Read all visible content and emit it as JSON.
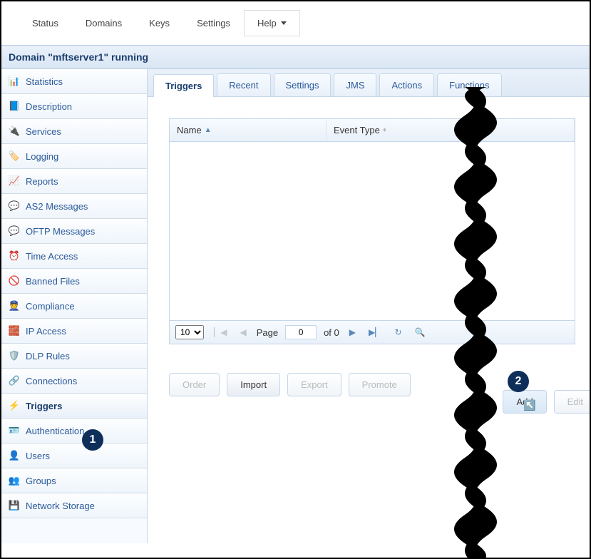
{
  "topnav": {
    "status": "Status",
    "domains": "Domains",
    "keys": "Keys",
    "settings": "Settings",
    "help": "Help"
  },
  "domain_bar": "Domain \"mftserver1\" running",
  "sidebar": [
    {
      "label": "Statistics",
      "icon": "📊"
    },
    {
      "label": "Description",
      "icon": "📘"
    },
    {
      "label": "Services",
      "icon": "🔌"
    },
    {
      "label": "Logging",
      "icon": "🏷️"
    },
    {
      "label": "Reports",
      "icon": "📈"
    },
    {
      "label": "AS2 Messages",
      "icon": "💬"
    },
    {
      "label": "OFTP Messages",
      "icon": "💬"
    },
    {
      "label": "Time Access",
      "icon": "⏰"
    },
    {
      "label": "Banned Files",
      "icon": "🚫"
    },
    {
      "label": "Compliance",
      "icon": "👮"
    },
    {
      "label": "IP Access",
      "icon": "🧱"
    },
    {
      "label": "DLP Rules",
      "icon": "🛡️"
    },
    {
      "label": "Connections",
      "icon": "🔗"
    },
    {
      "label": "Triggers",
      "icon": "⚡",
      "active": true
    },
    {
      "label": "Authentication",
      "icon": "🪪"
    },
    {
      "label": "Users",
      "icon": "👤"
    },
    {
      "label": "Groups",
      "icon": "👥"
    },
    {
      "label": "Network Storage",
      "icon": "💾"
    }
  ],
  "tabs": [
    {
      "label": "Triggers",
      "active": true
    },
    {
      "label": "Recent"
    },
    {
      "label": "Settings"
    },
    {
      "label": "JMS"
    },
    {
      "label": "Actions"
    },
    {
      "label": "Functions"
    }
  ],
  "grid": {
    "columns": {
      "name": "Name",
      "event": "Event Type"
    },
    "rows": [],
    "pager": {
      "page_size": "10",
      "page_label": "Page",
      "page_num": "0",
      "of_label": "of 0"
    }
  },
  "buttons": {
    "order": "Order",
    "import": "Import",
    "export": "Export",
    "promote": "Promote",
    "add": "Add",
    "edit": "Edit"
  },
  "callouts": {
    "one": "1",
    "two": "2"
  }
}
